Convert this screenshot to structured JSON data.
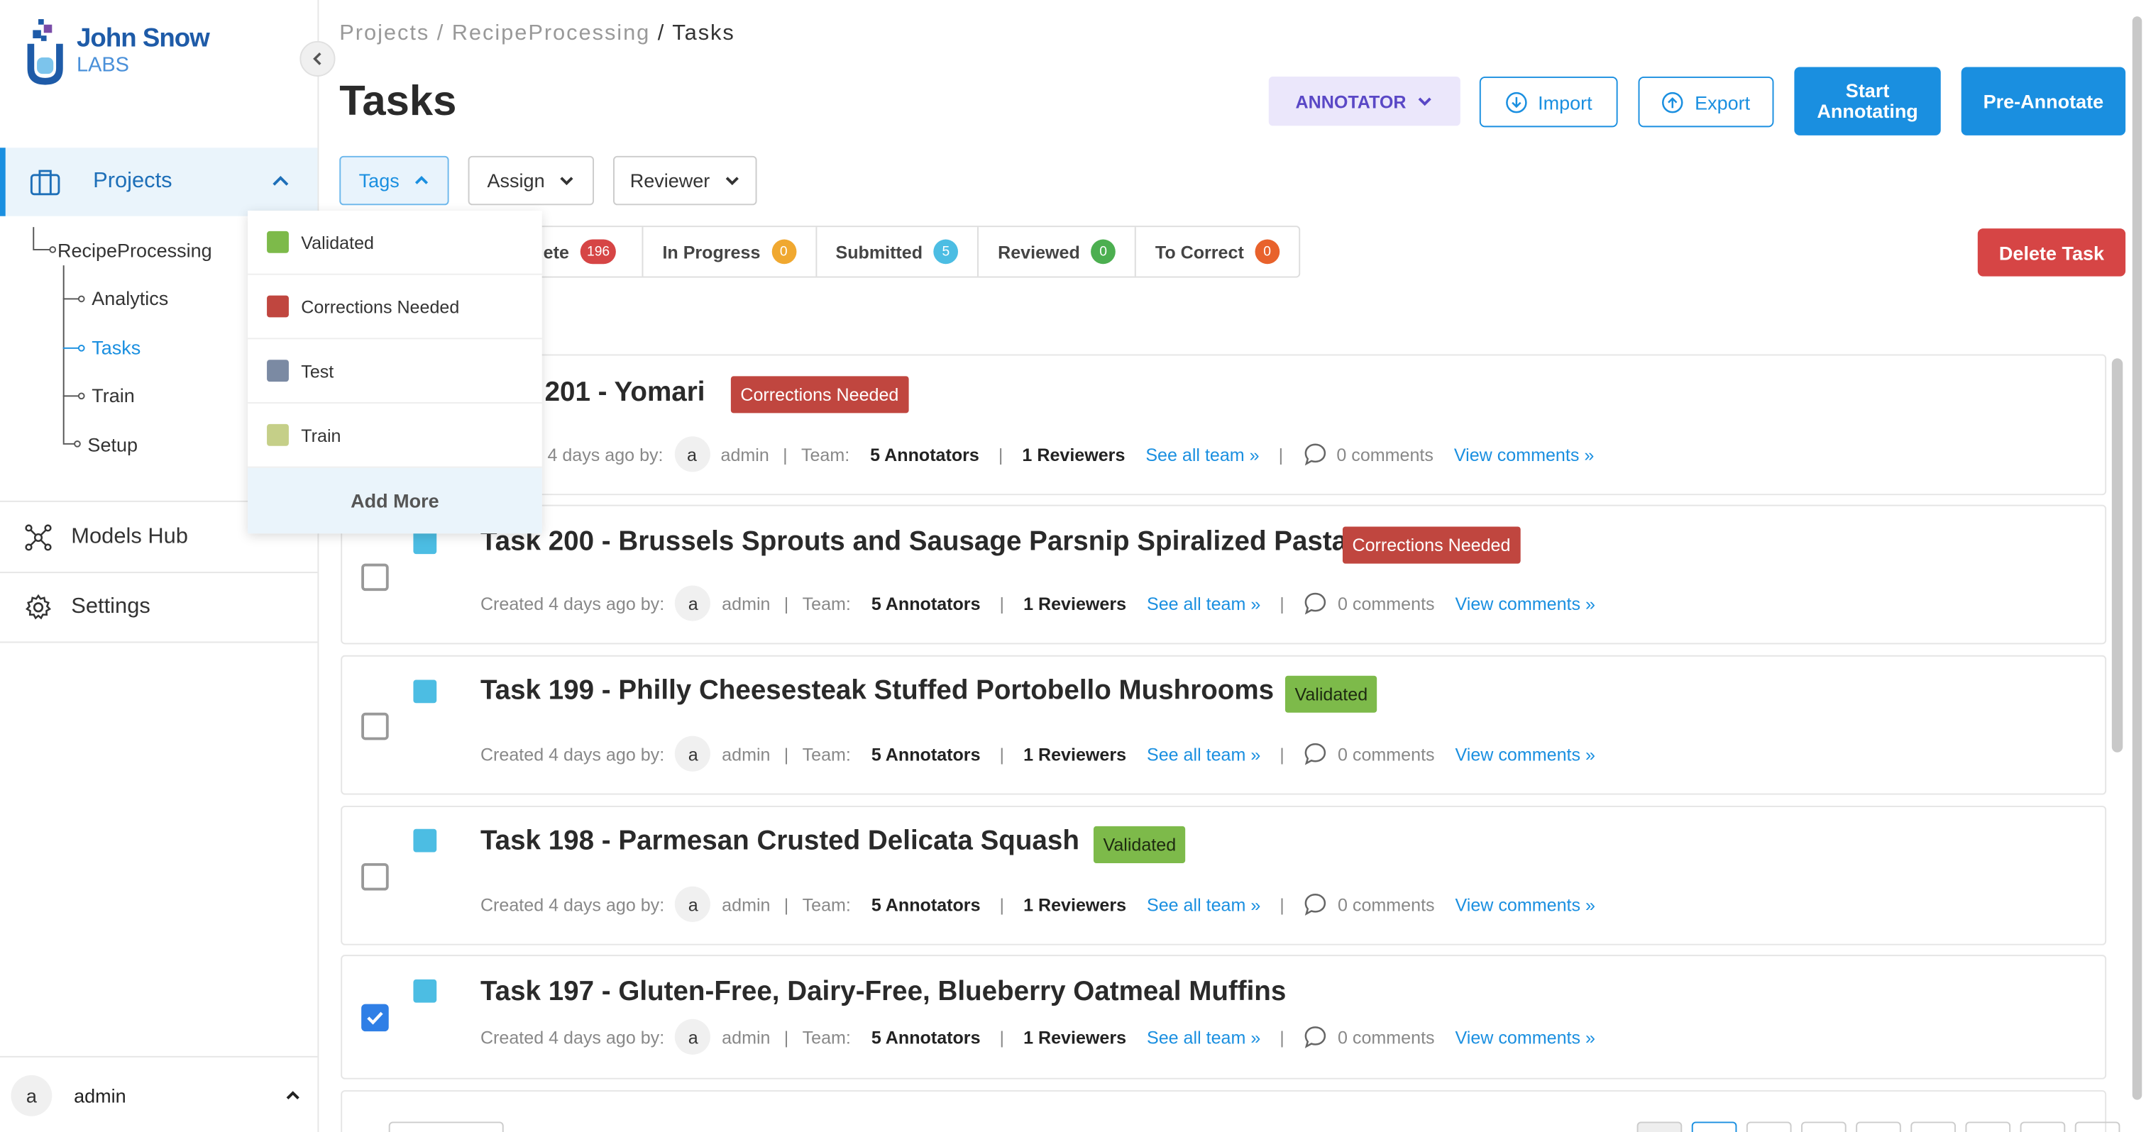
{
  "sidebar": {
    "logo": {
      "line1": "John Snow",
      "line2": "LABS"
    },
    "projects_label": "Projects",
    "tree": {
      "project": "RecipeProcessing",
      "items": [
        "Analytics",
        "Tasks",
        "Train",
        "Setup"
      ]
    },
    "models_hub_label": "Models Hub",
    "settings_label": "Settings",
    "user": {
      "avatar": "a",
      "name": "admin"
    }
  },
  "header": {
    "breadcrumb": {
      "root": "Projects",
      "project": "RecipeProcessing",
      "current": "Tasks"
    },
    "title": "Tasks",
    "role_button": "ANNOTATOR",
    "import_label": "Import",
    "export_label": "Export",
    "start_annotating_label": "Start Annotating",
    "pre_annotate_label": "Pre-Annotate"
  },
  "filters": {
    "tags": "Tags",
    "assign": "Assign",
    "reviewer": "Reviewer"
  },
  "status_tabs": [
    {
      "label": "ete",
      "count": "196",
      "color": "#d64545"
    },
    {
      "label": "In Progress",
      "count": "0",
      "color": "#f0a830"
    },
    {
      "label": "Submitted",
      "count": "5",
      "color": "#4cbde3"
    },
    {
      "label": "Reviewed",
      "count": "0",
      "color": "#4caf50"
    },
    {
      "label": "To Correct",
      "count": "0",
      "color": "#e8622c"
    }
  ],
  "delete_label": "Delete Task",
  "tags_dropdown": {
    "items": [
      {
        "label": "Validated",
        "color": "#7dba4a"
      },
      {
        "label": "Corrections Needed",
        "color": "#c0463f"
      },
      {
        "label": "Test",
        "color": "#7b8aa3"
      },
      {
        "label": "Train",
        "color": "#c5cf88"
      }
    ],
    "add_more": "Add More"
  },
  "task_meta": {
    "created": "Created 4 days ago by:",
    "avatar": "a",
    "user": "admin",
    "team_label": "Team:",
    "annotators": "5 Annotators",
    "reviewers": "1 Reviewers",
    "see_team": "See all team »",
    "comments": "0 comments",
    "view_comments": "View comments »"
  },
  "tasks": [
    {
      "title": "201 - Yomari",
      "tag": "Corrections Needed",
      "meta_prefix": "4 days ago by:"
    },
    {
      "title": "Task 200 - Brussels Sprouts and Sausage Parsnip Spiralized Pasta",
      "tag": "Corrections Needed"
    },
    {
      "title": "Task 199 - Philly Cheesesteak Stuffed Portobello Mushrooms",
      "tag": "Validated"
    },
    {
      "title": "Task 198 - Parmesan Crusted Delicata Squash",
      "tag": "Validated"
    },
    {
      "title": "Task 197 - Gluten-Free, Dairy-Free, Blueberry Oatmeal Muffins",
      "tag": ""
    }
  ]
}
